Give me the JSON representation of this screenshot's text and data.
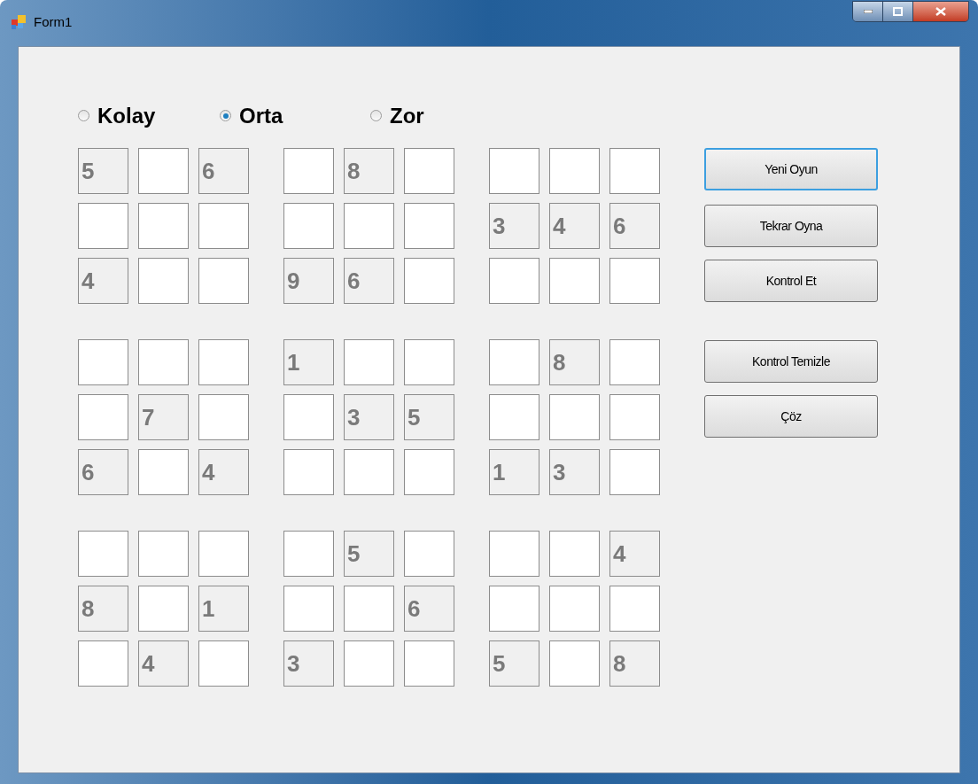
{
  "window": {
    "title": "Form1"
  },
  "difficulty": [
    {
      "label": "Kolay",
      "selected": false
    },
    {
      "label": "Orta",
      "selected": true
    },
    {
      "label": "Zor",
      "selected": false
    }
  ],
  "grid": [
    [
      {
        "value": "5",
        "disabled": true
      },
      {
        "disabled": false
      },
      {
        "value": "6",
        "disabled": true
      },
      {
        "disabled": false
      },
      {
        "value": "8",
        "disabled": true
      },
      {
        "disabled": false
      },
      {
        "disabled": false
      },
      {
        "disabled": false
      },
      {
        "disabled": false
      }
    ],
    [
      {
        "disabled": false
      },
      {
        "disabled": false
      },
      {
        "disabled": false
      },
      {
        "disabled": false
      },
      {
        "disabled": false
      },
      {
        "disabled": false
      },
      {
        "value": "3",
        "disabled": true
      },
      {
        "value": "4",
        "disabled": true
      },
      {
        "value": "6",
        "disabled": true
      }
    ],
    [
      {
        "value": "4",
        "disabled": true
      },
      {
        "disabled": false
      },
      {
        "disabled": false
      },
      {
        "value": "9",
        "disabled": true
      },
      {
        "value": "6",
        "disabled": true
      },
      {
        "disabled": false
      },
      {
        "disabled": false
      },
      {
        "disabled": false
      },
      {
        "disabled": false
      }
    ],
    [
      {
        "disabled": false
      },
      {
        "disabled": false
      },
      {
        "disabled": false
      },
      {
        "value": "1",
        "disabled": true
      },
      {
        "disabled": false
      },
      {
        "disabled": false
      },
      {
        "disabled": false
      },
      {
        "value": "8",
        "disabled": true
      },
      {
        "disabled": false
      }
    ],
    [
      {
        "disabled": false
      },
      {
        "value": "7",
        "disabled": true
      },
      {
        "disabled": false
      },
      {
        "disabled": false
      },
      {
        "value": "3",
        "disabled": true
      },
      {
        "value": "5",
        "disabled": true
      },
      {
        "disabled": false
      },
      {
        "disabled": false
      },
      {
        "disabled": false
      }
    ],
    [
      {
        "value": "6",
        "disabled": true
      },
      {
        "disabled": false
      },
      {
        "value": "4",
        "disabled": true
      },
      {
        "disabled": false
      },
      {
        "disabled": false
      },
      {
        "disabled": false
      },
      {
        "value": "1",
        "disabled": true
      },
      {
        "value": "3",
        "disabled": true
      },
      {
        "disabled": false
      }
    ],
    [
      {
        "disabled": false
      },
      {
        "disabled": false
      },
      {
        "disabled": false
      },
      {
        "disabled": false
      },
      {
        "value": "5",
        "disabled": true
      },
      {
        "disabled": false
      },
      {
        "disabled": false
      },
      {
        "disabled": false
      },
      {
        "value": "4",
        "disabled": true
      }
    ],
    [
      {
        "value": "8",
        "disabled": true
      },
      {
        "disabled": false
      },
      {
        "value": "1",
        "disabled": true
      },
      {
        "disabled": false
      },
      {
        "disabled": false
      },
      {
        "value": "6",
        "disabled": true
      },
      {
        "disabled": false
      },
      {
        "disabled": false
      },
      {
        "disabled": false
      }
    ],
    [
      {
        "disabled": false
      },
      {
        "value": "4",
        "disabled": true
      },
      {
        "disabled": false
      },
      {
        "value": "3",
        "disabled": true
      },
      {
        "disabled": false
      },
      {
        "disabled": false
      },
      {
        "value": "5",
        "disabled": true
      },
      {
        "disabled": false
      },
      {
        "value": "8",
        "disabled": true
      }
    ]
  ],
  "buttons": [
    {
      "label": "Yeni Oyun",
      "focused": true
    },
    {
      "label": "Tekrar Oyna",
      "focused": false
    },
    {
      "label": "Kontrol Et",
      "focused": false
    },
    {
      "label": "Kontrol Temizle",
      "focused": false
    },
    {
      "label": "Çöz",
      "focused": false
    }
  ]
}
